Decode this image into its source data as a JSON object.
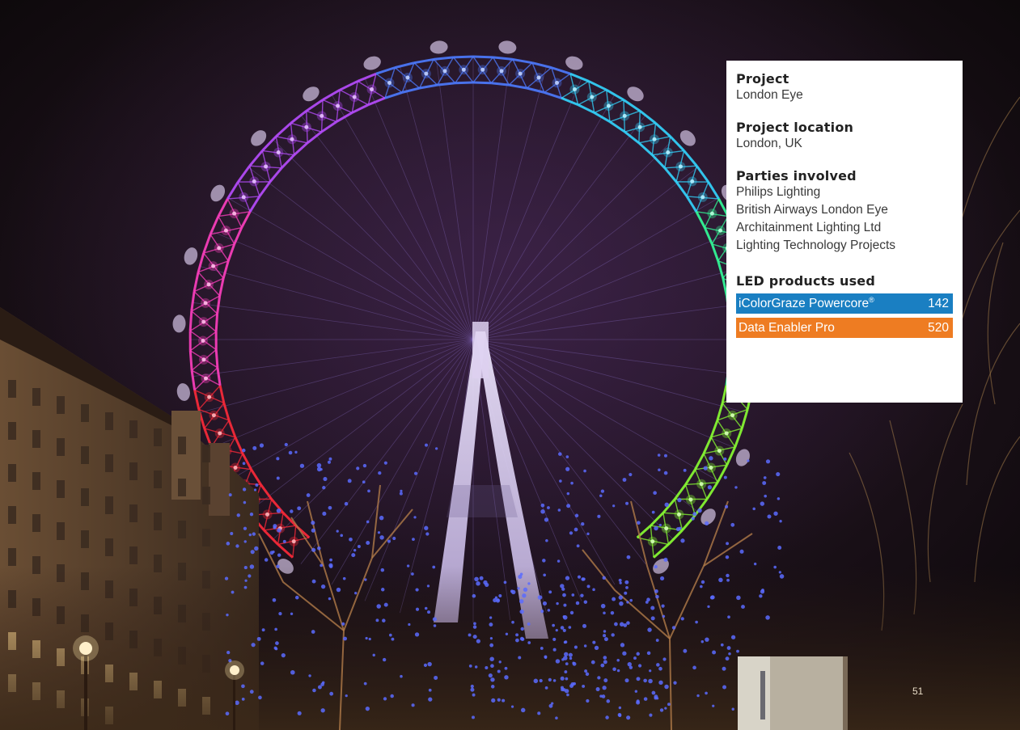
{
  "colors": {
    "panel_bg": "#ffffff",
    "heading": "#222222",
    "text": "#3a3a3a",
    "product_blue": "#1a7fc2",
    "product_orange": "#ee7c22",
    "page_number": "#e8dcc6"
  },
  "photo": {
    "subject": "London Eye at night",
    "wheel_colors": [
      "#ff2a3a",
      "#ff3fc0",
      "#b84dff",
      "#4d7bff",
      "#33d6ff",
      "#33ff9a",
      "#8aff33"
    ],
    "tree_light_color": "#5a6bff"
  },
  "info": {
    "project_heading": "Project",
    "project_value": "London Eye",
    "location_heading": "Project location",
    "location_value": "London, UK",
    "parties_heading": "Parties involved",
    "parties": [
      "Philips Lighting",
      "British Airways London Eye",
      "Architainment Lighting Ltd",
      "Lighting Technology Projects"
    ],
    "products_heading": "LED products used",
    "products": [
      {
        "name": "iColorGraze Powercore",
        "mark": "®",
        "count": "142",
        "color": "#1a7fc2"
      },
      {
        "name": "Data Enabler Pro",
        "mark": "",
        "count": "520",
        "color": "#ee7c22"
      }
    ]
  },
  "page_number": "51"
}
